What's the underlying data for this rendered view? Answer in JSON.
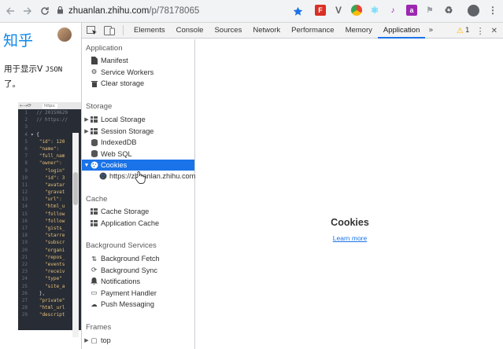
{
  "browser": {
    "back_icon": "arrow-left-icon",
    "forward_icon": "arrow-right-icon",
    "reload_icon": "reload-icon",
    "url_host": "zhuanlan.zhihu.com",
    "url_path": "/p/78178065",
    "bookmark_icon": "star-icon",
    "extensions": [
      "ext-red",
      "ext-v",
      "ext-chrome",
      "ext-react",
      "ext-purple",
      "ext-flag",
      "ext-recycle"
    ],
    "profile_icon": "account-icon",
    "menu_icon": "more-vert-icon"
  },
  "page": {
    "logo": "知乎",
    "text_line1_cn": "用于显示V ",
    "text_line1_mono": "JSON",
    "text_line2": "了。",
    "screenshot_url": "https:",
    "code_lines": [
      {
        "n": "1",
        "t": "  // 20150629",
        "cls": "cm"
      },
      {
        "n": "2",
        "t": "  // https://",
        "cls": "cm"
      },
      {
        "n": "3",
        "t": "",
        "cls": ""
      },
      {
        "n": "4",
        "t": "▾ {",
        "cls": "br"
      },
      {
        "n": "5",
        "t": "   \"id\": 120",
        "cls": ""
      },
      {
        "n": "6",
        "t": "   \"name\": ",
        "cls": ""
      },
      {
        "n": "7",
        "t": "   \"full_nam",
        "cls": ""
      },
      {
        "n": "8",
        "t": "   \"owner\":",
        "cls": ""
      },
      {
        "n": "9",
        "t": "     \"login\"",
        "cls": ""
      },
      {
        "n": "10",
        "t": "     \"id\": 3",
        "cls": ""
      },
      {
        "n": "11",
        "t": "     \"avatar",
        "cls": ""
      },
      {
        "n": "12",
        "t": "     \"gravat",
        "cls": ""
      },
      {
        "n": "13",
        "t": "     \"url\":",
        "cls": ""
      },
      {
        "n": "14",
        "t": "     \"html_u",
        "cls": ""
      },
      {
        "n": "15",
        "t": "     \"follow",
        "cls": ""
      },
      {
        "n": "16",
        "t": "     \"follow",
        "cls": ""
      },
      {
        "n": "17",
        "t": "     \"gists_",
        "cls": ""
      },
      {
        "n": "18",
        "t": "     \"starre",
        "cls": ""
      },
      {
        "n": "19",
        "t": "     \"subscr",
        "cls": ""
      },
      {
        "n": "20",
        "t": "     \"organi",
        "cls": ""
      },
      {
        "n": "21",
        "t": "     \"repos_",
        "cls": ""
      },
      {
        "n": "22",
        "t": "     \"events",
        "cls": ""
      },
      {
        "n": "23",
        "t": "     \"receiv",
        "cls": ""
      },
      {
        "n": "24",
        "t": "     \"type\"",
        "cls": ""
      },
      {
        "n": "25",
        "t": "     \"site_a",
        "cls": ""
      },
      {
        "n": "26",
        "t": "   },",
        "cls": "br"
      },
      {
        "n": "27",
        "t": "   \"private\"",
        "cls": ""
      },
      {
        "n": "28",
        "t": "   \"html_url",
        "cls": ""
      },
      {
        "n": "29",
        "t": "   \"descript",
        "cls": ""
      }
    ]
  },
  "devtools": {
    "tabs": [
      "Elements",
      "Console",
      "Sources",
      "Network",
      "Performance",
      "Memory",
      "Application"
    ],
    "active_tab": "Application",
    "more_tabs": "»",
    "warning_count": "1",
    "sidebar": {
      "application_title": "Application",
      "application_items": [
        {
          "label": "Manifest",
          "icon": "document-icon"
        },
        {
          "label": "Service Workers",
          "icon": "gear-icon"
        },
        {
          "label": "Clear storage",
          "icon": "trash-icon"
        }
      ],
      "storage_title": "Storage",
      "storage_items": [
        {
          "label": "Local Storage",
          "icon": "grid-icon",
          "expand": "▶"
        },
        {
          "label": "Session Storage",
          "icon": "grid-icon",
          "expand": "▶"
        },
        {
          "label": "IndexedDB",
          "icon": "database-icon",
          "expand": ""
        },
        {
          "label": "Web SQL",
          "icon": "database-icon",
          "expand": ""
        },
        {
          "label": "Cookies",
          "icon": "cookie-icon",
          "expand": "▼"
        }
      ],
      "cookie_child": "https://zhuanlan.zhihu.com",
      "cache_title": "Cache",
      "cache_items": [
        {
          "label": "Cache Storage",
          "icon": "grid-icon"
        },
        {
          "label": "Application Cache",
          "icon": "grid-icon"
        }
      ],
      "background_title": "Background Services",
      "background_items": [
        {
          "label": "Background Fetch",
          "icon": "swap-arrows-icon"
        },
        {
          "label": "Background Sync",
          "icon": "sync-icon"
        },
        {
          "label": "Notifications",
          "icon": "bell-icon"
        },
        {
          "label": "Payment Handler",
          "icon": "card-icon"
        },
        {
          "label": "Push Messaging",
          "icon": "cloud-icon"
        }
      ],
      "frames_title": "Frames",
      "frames_items": [
        {
          "label": "top",
          "icon": "frame-icon",
          "expand": "▶"
        }
      ]
    },
    "main": {
      "title": "Cookies",
      "link": "Learn more"
    }
  }
}
